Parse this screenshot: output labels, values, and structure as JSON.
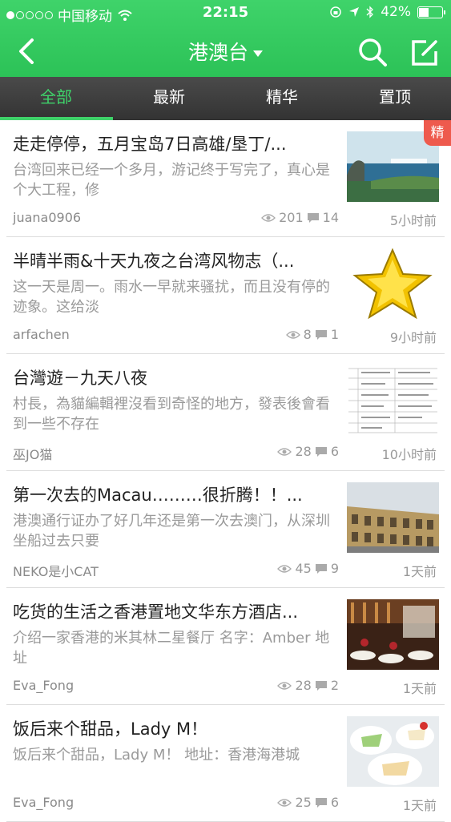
{
  "status_bar": {
    "carrier": "中国移动",
    "time": "22:15",
    "battery": "42%"
  },
  "nav": {
    "title": "港澳台"
  },
  "tabs": [
    {
      "label": "全部",
      "active": true
    },
    {
      "label": "最新",
      "active": false
    },
    {
      "label": "精华",
      "active": false
    },
    {
      "label": "置顶",
      "active": false
    }
  ],
  "posts": [
    {
      "title": "走走停停，五月宝岛7日高雄/垦丁/...",
      "summary": "台湾回来已经一个多月，游记终于写完了，真心是个大工程，修",
      "author": "juana0906",
      "views": "201",
      "comments": "14",
      "time": "5小时前",
      "badge": "精"
    },
    {
      "title": "半晴半雨&十天九夜之台湾风物志（...",
      "summary": "这一天是周一。雨水一早就来骚扰，而且没有停的迹象。这给淡",
      "author": "arfachen",
      "views": "8",
      "comments": "1",
      "time": "9小时前"
    },
    {
      "title": "台灣遊－九天八夜",
      "summary": "村長，為貓編輯裡沒看到奇怪的地方，發表後會看到一些不存在",
      "author": "巫JO猫",
      "views": "28",
      "comments": "6",
      "time": "10小时前"
    },
    {
      "title": "第一次去的Macau………很折腾！！...",
      "summary": "港澳通行证办了好几年还是第一次去澳门，从深圳坐船过去只要",
      "author": "NEKO是小CAT",
      "views": "45",
      "comments": "9",
      "time": "1天前"
    },
    {
      "title": "吃货的生活之香港置地文华东方酒店...",
      "summary": "介绍一家香港的米其林二星餐厅  名字：Amber  地址",
      "author": "Eva_Fong",
      "views": "28",
      "comments": "2",
      "time": "1天前"
    },
    {
      "title": "饭后来个甜品，Lady M！",
      "summary": "饭后来个甜品，Lady M！  地址：香港海港城",
      "author": "Eva_Fong",
      "views": "25",
      "comments": "6",
      "time": "1天前"
    }
  ]
}
